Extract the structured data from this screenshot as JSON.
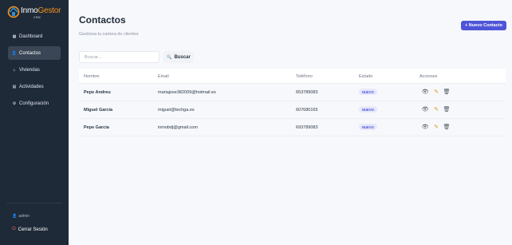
{
  "brand": {
    "name_part1": "Inmo",
    "name_part2": "Gestor",
    "sub": "CRM",
    "accent": "#f7941d"
  },
  "sidebar": {
    "items": [
      {
        "label": "Dashboard",
        "icon": "dashboard-icon"
      },
      {
        "label": "Contactos",
        "icon": "user-icon",
        "active": true
      },
      {
        "label": "Viviendas",
        "icon": "house-icon"
      },
      {
        "label": "Actividades",
        "icon": "calendar-icon"
      },
      {
        "label": "Configuración",
        "icon": "gear-icon"
      }
    ],
    "user": "admin",
    "logout": "Cerrar Sesión"
  },
  "page": {
    "title": "Contactos",
    "subtitle": "Gestiona tu cartera de clientes",
    "new_button": "+ Nuevo Contacto"
  },
  "search": {
    "placeholder": "Buscar...",
    "value": "",
    "button": "Buscar"
  },
  "table": {
    "headers": [
      "Nombre",
      "Email",
      "Teléfono",
      "Estado",
      "Acciones"
    ],
    "rows": [
      {
        "name": "Pepe Andreu",
        "email": "mariajose382009@hotmail.es",
        "phone": "653789083",
        "status": "NUEVO"
      },
      {
        "name": "Miguel García",
        "email": "miguel@techga.es",
        "phone": "607680165",
        "status": "NUEVO"
      },
      {
        "name": "Pepe Garcia",
        "email": "inmobdj@gmail.com",
        "phone": "693789083",
        "status": "NUEVO"
      }
    ]
  },
  "colors": {
    "sidebar_bg": "#1f2a38",
    "primary": "#4f54d8",
    "edit_icon": "#d89a1f"
  }
}
